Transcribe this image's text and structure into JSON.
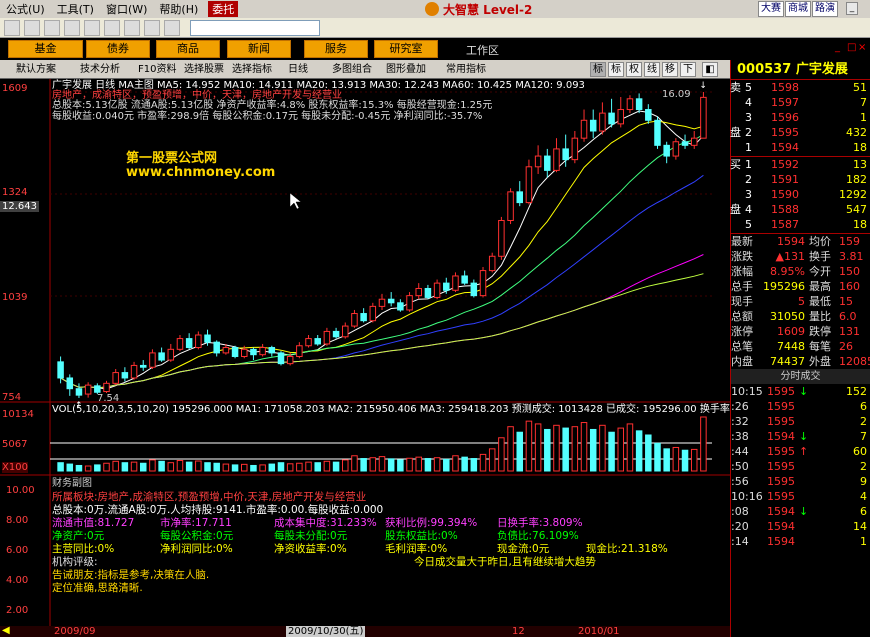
{
  "menu": [
    "公式(U)",
    "工具(T)",
    "窗口(W)",
    "帮助(H)"
  ],
  "trust_label": "委托",
  "brand": "大智慧 Level-2",
  "top_right_buttons": [
    "大赛",
    "商城",
    "路演"
  ],
  "nav_buttons": [
    "基金",
    "债券",
    "商品",
    "新闻",
    "服务",
    "研究室"
  ],
  "workspace_label": "工作区",
  "tabs": [
    "默认方案",
    "技术分析",
    "F10资料",
    "选择股票",
    "选择指标",
    "日线",
    "多图组合",
    "图形叠加",
    "常用指标"
  ],
  "period_switches": [
    "标",
    "标",
    "权",
    "线",
    "移",
    "下"
  ],
  "stock": {
    "code": "000537",
    "name": "广宇发展"
  },
  "kline_header": "广宇发展 日线 MA主图 MA5: 14.952 MA10: 14.911 MA20: 13.913 MA30: 12.243 MA60: 10.425 MA120: 9.093",
  "concepts": "房地产，成渝特区，预盈预增，中价，天津，房地产开发与经营业",
  "fin_rows": [
    "总股本:5.13亿股   流通A股:5.13亿股   净资产收益率:4.8%   股东权益率:15.3%   每股经营现金:1.25元",
    "每股收益:0.040元   市盈率:298.9倍   每股公积金:0.17元   每股未分配:-0.45元   净利润同比:-35.7%"
  ],
  "watermark": [
    "第一股票公式网",
    "www.chnmoney.com"
  ],
  "price_axis": [
    "1609",
    "1324",
    "1039",
    "754"
  ],
  "cursor_price": "12.643",
  "hi_label": "16.09",
  "lo_label": "7.54",
  "volume_axis": [
    "10134",
    "5067",
    "X100"
  ],
  "volume_header": "VOL(5,10,20,3,5,10,20)  195296.000  MA1: 171058.203  MA2: 215950.406  MA3: 259418.203  预测成交: 1013428  已成交: 195296.00  换手率: 3",
  "panel_axis": [
    "10.00",
    "8.00",
    "6.00",
    "4.00",
    "2.00"
  ],
  "panel_title": "财务副图",
  "panel_rows": {
    "sector": "所属板块:房地产,成渝特区,预盈预增,中价,天津,房地产开发与经营业",
    "shares": "总股本:0万.流通A股:0万.人均持股:9141.市盈率:0.00.每股收益:0.000",
    "r3": [
      "流通市值:81.727",
      "市净率:17.711",
      "成本集中度:31.233%",
      "获利比例:99.394%",
      "日换手率:3.809%"
    ],
    "r4": [
      "净资产:0元",
      "每股公积金:0元",
      "每股未分配:0元",
      "股东权益比:0%",
      "负债比:76.109%"
    ],
    "r5": [
      "主营同比:0%",
      "净利润同比:0%",
      "净资收益率:0%",
      "毛利润率:0%",
      "现金流:0元",
      "现金比:21.318%"
    ],
    "rating": "机构评级:",
    "trend": "今日成交量大于昨日,且有继续增大趋势",
    "notice1": "告诫朋友:指标是参考,决策在人脑.",
    "notice2": "定位准确,思路清晰."
  },
  "date_axis": [
    "2009/09",
    "2009/10/30(五)",
    "12",
    "2010/01"
  ],
  "sells": [
    {
      "label": "5",
      "price": "1598",
      "vol": "51"
    },
    {
      "label": "4",
      "price": "1597",
      "vol": "7"
    },
    {
      "label": "3",
      "price": "1596",
      "vol": "1"
    },
    {
      "label": "2",
      "price": "1595",
      "vol": "432"
    },
    {
      "label": "1",
      "price": "1594",
      "vol": "18"
    }
  ],
  "sell_chars": [
    "卖",
    "盘"
  ],
  "buys": [
    {
      "label": "1",
      "price": "1592",
      "vol": "13"
    },
    {
      "label": "2",
      "price": "1591",
      "vol": "182"
    },
    {
      "label": "3",
      "price": "1590",
      "vol": "1292"
    },
    {
      "label": "4",
      "price": "1588",
      "vol": "547"
    },
    {
      "label": "5",
      "price": "1587",
      "vol": "18"
    }
  ],
  "buy_chars": [
    "买",
    "盘"
  ],
  "stats": [
    [
      "最新",
      "1594",
      "均价",
      "159"
    ],
    [
      "涨跌",
      "▲131",
      "换手",
      "3.81"
    ],
    [
      "涨幅",
      "8.95%",
      "今开",
      "150"
    ],
    [
      "总手",
      "195296",
      "最高",
      "160"
    ],
    [
      "现手",
      "5",
      "最低",
      "15"
    ],
    [
      "总额",
      "31050",
      "量比",
      "6.0"
    ],
    [
      "涨停",
      "1609",
      "跌停",
      "131"
    ],
    [
      "总笔",
      "7448",
      "每笔",
      "26"
    ],
    [
      "内盘",
      "74437",
      "外盘",
      "12085"
    ]
  ],
  "ticks_header": "分时成交",
  "ticks": [
    {
      "time": "10:15",
      "price": "1595",
      "vol": "152",
      "dir": "down"
    },
    {
      "time": ":26",
      "price": "1595",
      "vol": "6",
      "dir": "none"
    },
    {
      "time": ":32",
      "price": "1595",
      "vol": "2",
      "dir": "none"
    },
    {
      "time": ":38",
      "price": "1594",
      "vol": "7",
      "dir": "down"
    },
    {
      "time": ":44",
      "price": "1595",
      "vol": "60",
      "dir": "up"
    },
    {
      "time": ":50",
      "price": "1595",
      "vol": "2",
      "dir": "none"
    },
    {
      "time": ":56",
      "price": "1595",
      "vol": "9",
      "dir": "none"
    },
    {
      "time": "10:16",
      "price": "1595",
      "vol": "4",
      "dir": "none"
    },
    {
      "time": ":08",
      "price": "1594",
      "vol": "6",
      "dir": "down"
    },
    {
      "time": ":20",
      "price": "1594",
      "vol": "14",
      "dir": "none"
    },
    {
      "time": ":14",
      "price": "1594",
      "vol": "1",
      "dir": "none"
    }
  ],
  "colors": {
    "up": "#ff3030",
    "down": "#54ffff",
    "ma5": "#ffffff",
    "ma10": "#ffff00",
    "ma20": "#ff00ff",
    "ma30": "#00ff00",
    "ma60": "#0066ff",
    "ma120": "#ffff80"
  },
  "chart_data": {
    "type": "candlestick",
    "price_range": [
      7.54,
      16.09
    ],
    "candles": [
      [
        8.55,
        8.1,
        8.7,
        7.95
      ],
      [
        8.1,
        7.8,
        8.2,
        7.6
      ],
      [
        7.8,
        7.62,
        7.95,
        7.54
      ],
      [
        7.65,
        7.9,
        7.98,
        7.55
      ],
      [
        7.88,
        7.7,
        7.95,
        7.65
      ],
      [
        7.72,
        7.95,
        8.02,
        7.68
      ],
      [
        7.95,
        8.25,
        8.35,
        7.9
      ],
      [
        8.25,
        8.1,
        8.4,
        8.0
      ],
      [
        8.1,
        8.45,
        8.55,
        8.05
      ],
      [
        8.45,
        8.4,
        8.6,
        8.3
      ],
      [
        8.4,
        8.8,
        8.9,
        8.35
      ],
      [
        8.8,
        8.6,
        8.95,
        8.55
      ],
      [
        8.6,
        8.9,
        9.05,
        8.55
      ],
      [
        8.9,
        9.2,
        9.3,
        8.85
      ],
      [
        9.2,
        8.95,
        9.35,
        8.9
      ],
      [
        8.95,
        9.3,
        9.4,
        8.9
      ],
      [
        9.3,
        9.1,
        9.45,
        9.0
      ],
      [
        9.1,
        8.8,
        9.15,
        8.7
      ],
      [
        8.8,
        8.95,
        9.05,
        8.75
      ],
      [
        8.95,
        8.7,
        9.0,
        8.65
      ],
      [
        8.7,
        8.9,
        9.0,
        8.65
      ],
      [
        8.9,
        8.75,
        8.95,
        8.6
      ],
      [
        8.75,
        8.95,
        9.05,
        8.7
      ],
      [
        8.95,
        8.8,
        9.0,
        8.7
      ],
      [
        8.8,
        8.5,
        8.85,
        8.45
      ],
      [
        8.5,
        8.7,
        8.8,
        8.45
      ],
      [
        8.7,
        9.0,
        9.1,
        8.65
      ],
      [
        9.0,
        9.2,
        9.3,
        8.95
      ],
      [
        9.2,
        9.05,
        9.3,
        9.0
      ],
      [
        9.05,
        9.4,
        9.5,
        9.0
      ],
      [
        9.4,
        9.25,
        9.5,
        9.2
      ],
      [
        9.25,
        9.55,
        9.65,
        9.2
      ],
      [
        9.55,
        9.9,
        10.0,
        9.5
      ],
      [
        9.9,
        9.7,
        10.05,
        9.65
      ],
      [
        9.7,
        10.1,
        10.2,
        9.65
      ],
      [
        10.1,
        10.3,
        10.45,
        10.0
      ],
      [
        10.3,
        10.2,
        10.5,
        10.1
      ],
      [
        10.2,
        10.0,
        10.3,
        9.95
      ],
      [
        10.0,
        10.4,
        10.5,
        9.95
      ],
      [
        10.4,
        10.6,
        10.75,
        10.3
      ],
      [
        10.6,
        10.35,
        10.7,
        10.3
      ],
      [
        10.35,
        10.75,
        10.85,
        10.3
      ],
      [
        10.75,
        10.55,
        10.9,
        10.45
      ],
      [
        10.55,
        10.95,
        11.05,
        10.5
      ],
      [
        10.95,
        10.75,
        11.1,
        10.7
      ],
      [
        10.75,
        10.4,
        10.85,
        10.35
      ],
      [
        10.4,
        11.1,
        11.2,
        10.35
      ],
      [
        11.1,
        11.5,
        11.6,
        11.05
      ],
      [
        11.5,
        12.5,
        12.6,
        11.4
      ],
      [
        12.5,
        13.3,
        13.4,
        12.4
      ],
      [
        13.3,
        13.0,
        13.6,
        12.9
      ],
      [
        13.0,
        14.0,
        14.2,
        12.95
      ],
      [
        14.0,
        14.3,
        14.6,
        13.8
      ],
      [
        14.3,
        13.9,
        14.5,
        13.7
      ],
      [
        13.9,
        14.5,
        14.8,
        13.85
      ],
      [
        14.5,
        14.2,
        14.9,
        14.0
      ],
      [
        14.2,
        14.8,
        15.0,
        14.1
      ],
      [
        14.8,
        15.3,
        15.6,
        14.7
      ],
      [
        15.3,
        15.0,
        15.6,
        14.8
      ],
      [
        15.0,
        15.5,
        15.8,
        14.9
      ],
      [
        15.5,
        15.2,
        15.9,
        15.1
      ],
      [
        15.2,
        15.6,
        15.95,
        15.1
      ],
      [
        15.6,
        15.9,
        16.0,
        15.5
      ],
      [
        15.9,
        15.6,
        16.05,
        15.5
      ],
      [
        15.6,
        15.3,
        15.75,
        15.2
      ],
      [
        15.3,
        14.6,
        15.4,
        14.5
      ],
      [
        14.6,
        14.3,
        14.7,
        14.1
      ],
      [
        14.3,
        14.7,
        14.8,
        14.2
      ],
      [
        14.7,
        14.6,
        14.9,
        14.5
      ],
      [
        14.6,
        14.8,
        15.0,
        14.5
      ],
      [
        14.8,
        15.94,
        16.09,
        14.8
      ]
    ],
    "volume": [
      30,
      25,
      20,
      18,
      22,
      28,
      35,
      30,
      32,
      28,
      40,
      35,
      30,
      38,
      32,
      36,
      30,
      28,
      25,
      22,
      24,
      20,
      22,
      25,
      30,
      26,
      28,
      32,
      30,
      35,
      32,
      40,
      55,
      45,
      48,
      52,
      44,
      40,
      46,
      50,
      45,
      48,
      42,
      55,
      50,
      45,
      60,
      80,
      120,
      160,
      140,
      180,
      170,
      150,
      165,
      155,
      160,
      175,
      150,
      165,
      140,
      155,
      170,
      145,
      130,
      100,
      80,
      85,
      75,
      78,
      195
    ],
    "ma_values": {
      "ma5": 14.952,
      "ma10": 14.911,
      "ma20": 13.913,
      "ma30": 12.243,
      "ma60": 10.425,
      "ma120": 9.093
    }
  }
}
